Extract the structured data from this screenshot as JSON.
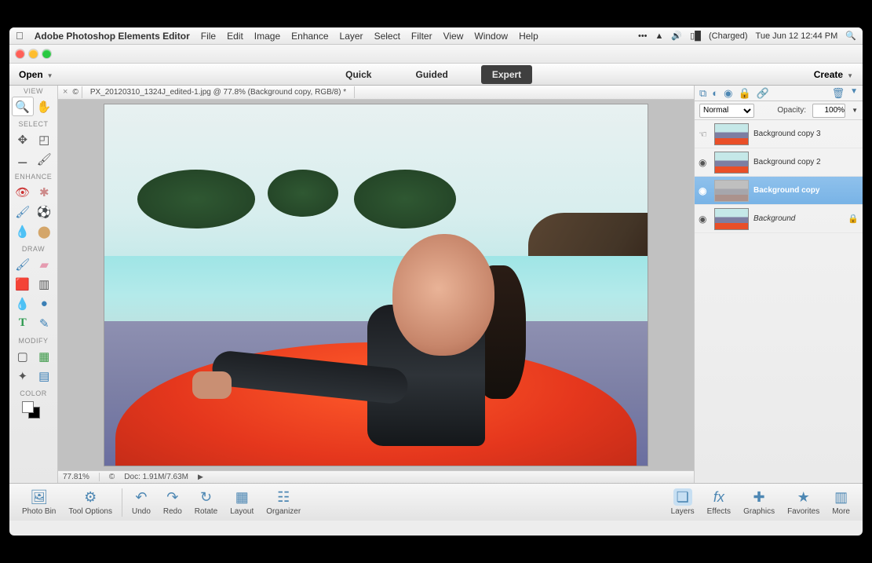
{
  "os_menubar": {
    "app_name": "Adobe Photoshop Elements Editor",
    "menus": [
      "File",
      "Edit",
      "Image",
      "Enhance",
      "Layer",
      "Select",
      "Filter",
      "View",
      "Window",
      "Help"
    ],
    "battery": "(Charged)",
    "datetime": "Tue Jun 12  12:44 PM"
  },
  "modebar": {
    "open": "Open",
    "tabs": [
      "Quick",
      "Guided",
      "Expert"
    ],
    "active_tab": "Expert",
    "create": "Create"
  },
  "doc_tab": {
    "title": "PX_20120310_1324J_edited-1.jpg @ 77.8% (Background copy, RGB/8) *"
  },
  "tool_sections": {
    "view": "VIEW",
    "select": "SELECT",
    "enhance": "ENHANCE",
    "draw": "DRAW",
    "modify": "MODIFY",
    "color": "COLOR"
  },
  "statusbar": {
    "zoom": "77.81%",
    "docinfo": "Doc: 1.91M/7.63M"
  },
  "layer_panel": {
    "blend_mode": "Normal",
    "opacity_label": "Opacity:",
    "opacity_value": "100%",
    "layers": [
      {
        "name": "Background copy 3",
        "visible": false,
        "selected": false,
        "thumb": "normal"
      },
      {
        "name": "Background copy 2",
        "visible": true,
        "selected": false,
        "thumb": "normal"
      },
      {
        "name": "Background copy",
        "visible": true,
        "selected": true,
        "thumb": "eff"
      },
      {
        "name": "Background",
        "visible": true,
        "selected": false,
        "italic": true,
        "locked": true,
        "thumb": "normal"
      }
    ]
  },
  "bottombar": {
    "left": [
      {
        "key": "photobin",
        "label": "Photo Bin"
      },
      {
        "key": "toolopts",
        "label": "Tool Options"
      }
    ],
    "mid": [
      {
        "key": "undo",
        "label": "Undo"
      },
      {
        "key": "redo",
        "label": "Redo"
      },
      {
        "key": "rotate",
        "label": "Rotate"
      },
      {
        "key": "layout",
        "label": "Layout"
      },
      {
        "key": "organizer",
        "label": "Organizer"
      }
    ],
    "right": [
      {
        "key": "layers",
        "label": "Layers",
        "active": true
      },
      {
        "key": "effects",
        "label": "Effects"
      },
      {
        "key": "graphics",
        "label": "Graphics"
      },
      {
        "key": "favorites",
        "label": "Favorites"
      },
      {
        "key": "more",
        "label": "More"
      }
    ]
  }
}
